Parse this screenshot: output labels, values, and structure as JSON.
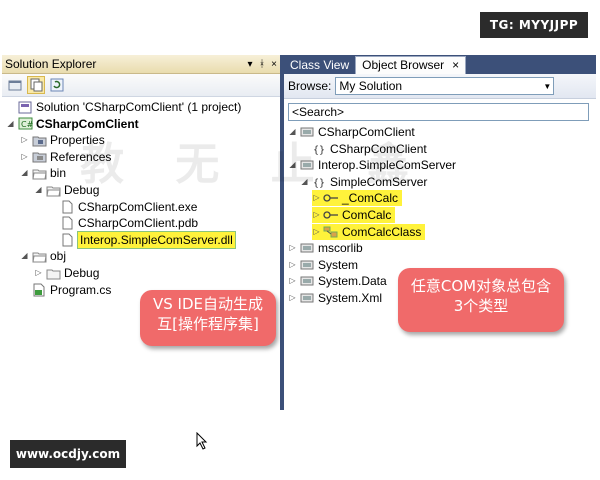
{
  "watermarks": {
    "tg": "TG: MYYJJPP",
    "url": "www.ocdjy.com"
  },
  "solution_explorer": {
    "title": "Solution Explorer",
    "controls": [
      "▾",
      "ᚼ",
      "×"
    ],
    "tree": [
      {
        "label": "Solution 'CSharpComClient' (1 project)",
        "icon": "solution-icon",
        "exp": ""
      },
      {
        "label": "CSharpComClient",
        "icon": "csharp-project-icon",
        "exp": "◢",
        "bold": true
      },
      {
        "label": "Properties",
        "icon": "properties-folder-icon",
        "exp": "▷"
      },
      {
        "label": "References",
        "icon": "references-folder-icon",
        "exp": "▷"
      },
      {
        "label": "bin",
        "icon": "folder-open-icon",
        "exp": "◢"
      },
      {
        "label": "Debug",
        "icon": "folder-open-icon",
        "exp": "◢"
      },
      {
        "label": "CSharpComClient.exe",
        "icon": "file-icon",
        "exp": ""
      },
      {
        "label": "CSharpComClient.pdb",
        "icon": "file-icon",
        "exp": ""
      },
      {
        "label": "Interop.SimpleComServer.dll",
        "icon": "file-icon",
        "exp": "",
        "highlight": true
      },
      {
        "label": "obj",
        "icon": "folder-open-icon",
        "exp": "◢"
      },
      {
        "label": "Debug",
        "icon": "folder-icon",
        "exp": "▷"
      },
      {
        "label": "Program.cs",
        "icon": "csharp-file-icon",
        "exp": ""
      }
    ]
  },
  "object_browser": {
    "tabs": [
      "Class View",
      "Object Browser"
    ],
    "tab_close": "×",
    "browse_label": "Browse:",
    "browse_value": "My Solution",
    "search_placeholder": "<Search>",
    "tree": [
      {
        "label": "CSharpComClient",
        "icon": "assembly-icon",
        "exp": "◢"
      },
      {
        "label": "CSharpComClient",
        "icon": "namespace-icon",
        "exp": ""
      },
      {
        "label": "Interop.SimpleComServer",
        "icon": "assembly-icon",
        "exp": "◢"
      },
      {
        "label": "SimpleComServer",
        "icon": "namespace-icon",
        "exp": "◢"
      },
      {
        "label": "_ComCalc",
        "icon": "interface-icon",
        "exp": "▷",
        "highlight": true
      },
      {
        "label": "ComCalc",
        "icon": "interface-icon",
        "exp": "▷",
        "highlight": true
      },
      {
        "label": "ComCalcClass",
        "icon": "class-icon",
        "exp": "▷",
        "highlight": true
      },
      {
        "label": "mscorlib",
        "icon": "assembly-icon",
        "exp": "▷"
      },
      {
        "label": "System",
        "icon": "assembly-icon",
        "exp": "▷"
      },
      {
        "label": "System.Data",
        "icon": "assembly-icon",
        "exp": "▷"
      },
      {
        "label": "System.Xml",
        "icon": "assembly-icon",
        "exp": "▷"
      }
    ]
  },
  "callouts": {
    "left": [
      "VS IDE自动生成",
      "互[操作程序集]"
    ],
    "right": [
      "任意COM对象总包含",
      "3个类型"
    ]
  },
  "colors": {
    "frame": "#3c5079",
    "callout": "#f06a6a",
    "highlight": "#fff23b"
  }
}
